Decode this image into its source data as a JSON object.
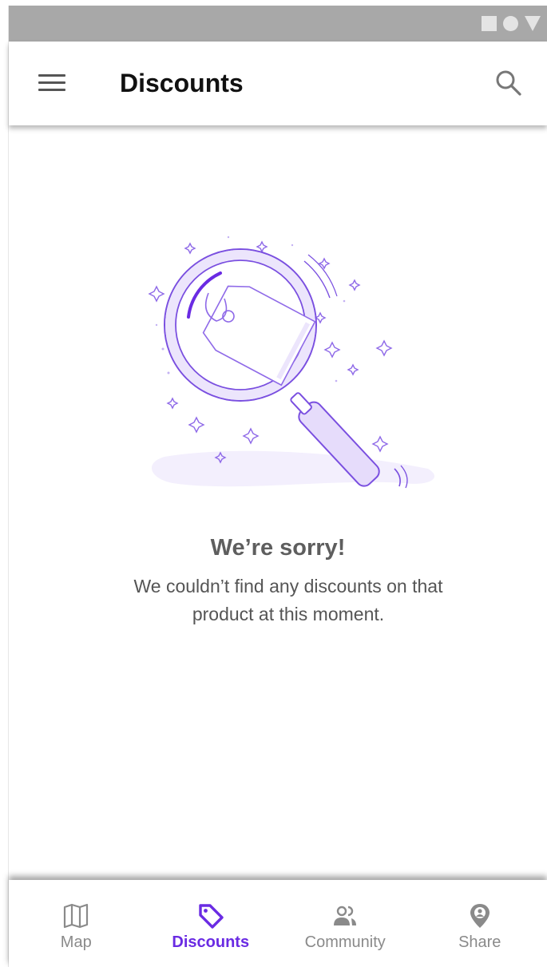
{
  "app_bar": {
    "title": "Discounts",
    "menu_icon": "hamburger-menu-icon",
    "search_icon": "search-icon"
  },
  "empty_state": {
    "illustration": "magnifying-glass-over-price-tag",
    "title": "We’re sorry!",
    "message": "We couldn’t find any discounts on that product at this moment."
  },
  "bottom_nav": {
    "items": [
      {
        "label": "Map",
        "icon": "map-icon",
        "active": false
      },
      {
        "label": "Discounts",
        "icon": "tag-icon",
        "active": true
      },
      {
        "label": "Community",
        "icon": "people-icon",
        "active": false
      },
      {
        "label": "Share",
        "icon": "location-pin-icon",
        "active": false
      }
    ]
  },
  "colors": {
    "accent": "#6a2be3",
    "status_bar": "#a8a8a8",
    "inactive_icon": "#8a8a8a",
    "illustration_light": "#ece5fc"
  }
}
